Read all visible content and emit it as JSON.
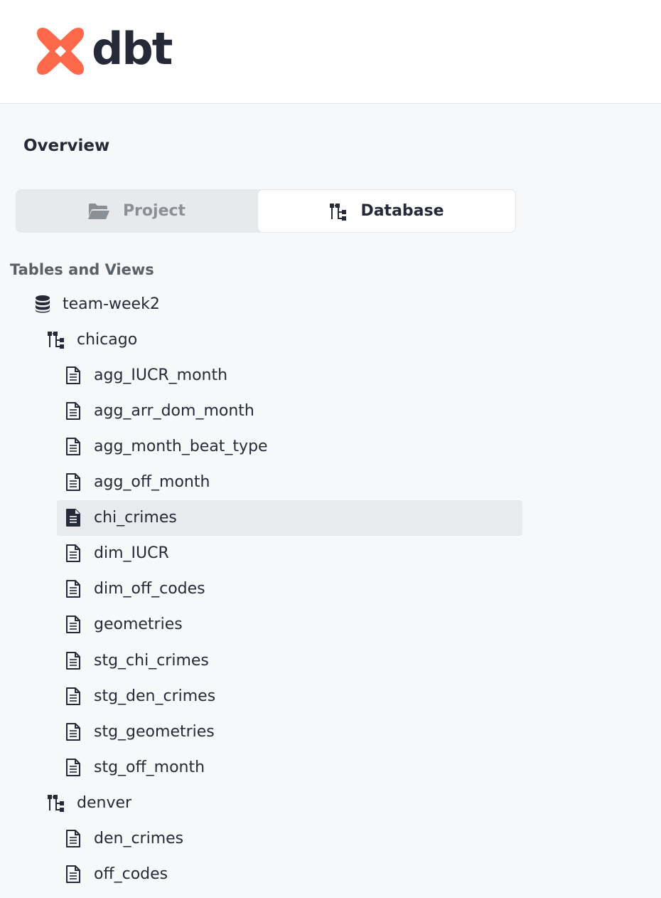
{
  "brand": {
    "name": "dbt",
    "accent": "#ff694b",
    "text_color": "#262a38"
  },
  "overview": {
    "title": "Overview"
  },
  "switcher": {
    "project_label": "Project",
    "database_label": "Database",
    "selected": "Database"
  },
  "tree": {
    "heading": "Tables and Views",
    "database": {
      "name": "team-week2",
      "icon": "database-icon"
    },
    "schemas": [
      {
        "name": "chicago",
        "icon": "schema-tree-icon",
        "tables": [
          "agg_IUCR_month",
          "agg_arr_dom_month",
          "agg_month_beat_type",
          "agg_off_month",
          "chi_crimes",
          "dim_IUCR",
          "dim_off_codes",
          "geometries",
          "stg_chi_crimes",
          "stg_den_crimes",
          "stg_geometries",
          "stg_off_month"
        ]
      },
      {
        "name": "denver",
        "icon": "schema-tree-icon",
        "tables": [
          "den_crimes",
          "off_codes"
        ]
      }
    ],
    "selected_table": "chi_crimes"
  }
}
